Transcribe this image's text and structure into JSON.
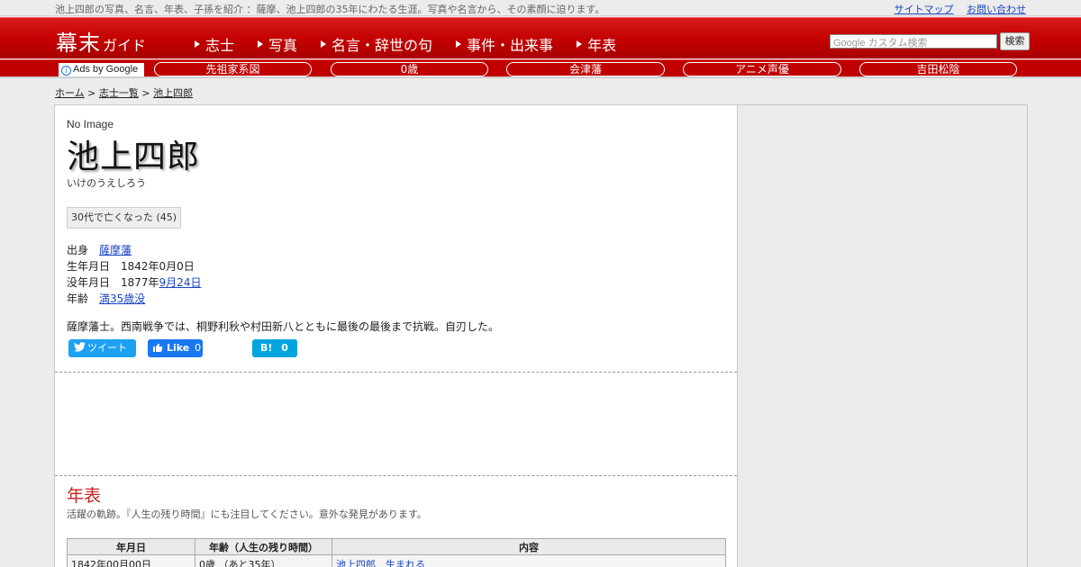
{
  "top": {
    "tagline": "池上四郎の写真、名言、年表、子孫を紹介 ：薩摩、池上四郎の35年にわたる生涯。写真や名言から、その素顔に迫ります。",
    "links": [
      "サイトマップ",
      "お問い合わせ"
    ]
  },
  "header": {
    "logo_main": "幕末",
    "logo_sub": "ガイド",
    "nav": [
      "志士",
      "写真",
      "名言・辞世の句",
      "事件・出来事",
      "年表"
    ],
    "search_placeholder": "Google カスタム検索",
    "search_button": "検索"
  },
  "adbar": {
    "ads_label": "Ads by Google",
    "links": [
      "先祖家系図",
      "0歳",
      "会津藩",
      "アニメ声優",
      "吉田松陰"
    ]
  },
  "breadcrumb": [
    "ホーム",
    "志士一覧",
    "池上四郎"
  ],
  "profile": {
    "no_image": "No Image",
    "name": "池上四郎",
    "kana": "いけのうえしろう",
    "tag": "30代で亡くなった (45)",
    "origin_label": "出身",
    "origin_value": "薩摩藩",
    "birth_label": "生年月日",
    "birth_value": "1842年0月0日",
    "death_label": "没年月日",
    "death_year": "1877年",
    "death_date": "9月24日",
    "age_label": "年齢",
    "age_value": "満35歳没",
    "description": "薩摩藩士。西南戦争では、桐野利秋や村田新八とともに最後の最後まで抗戦。自刃した。"
  },
  "social": {
    "tweet": "ツイート",
    "fb_like": "Like",
    "fb_count": "0",
    "hatena": "B!",
    "hatena_count": "0"
  },
  "timeline": {
    "title": "年表",
    "subtitle": "活躍の軌跡。『人生の残り時間』にも注目してください。意外な発見があります。",
    "headers": [
      "年月日",
      "年齢（人生の残り時間）",
      "内容"
    ],
    "rows": [
      {
        "date": "1842年00月00日",
        "age": "0歳 （あと35年）",
        "content": "池上四郎　生まれる"
      }
    ]
  }
}
